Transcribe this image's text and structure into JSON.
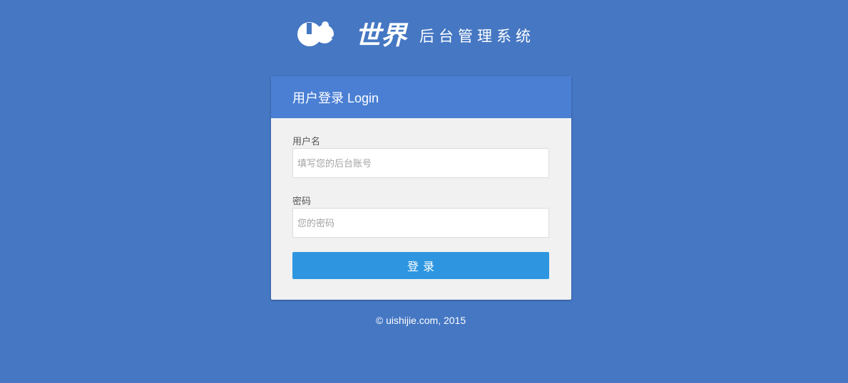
{
  "logo": {
    "mark_text": "UI世界",
    "subtitle": "后台管理系统"
  },
  "login": {
    "title": "用户登录 Login",
    "username_label": "用户名",
    "username_placeholder": "填写您的后台账号",
    "username_value": "",
    "password_label": "密码",
    "password_placeholder": "您的密码",
    "password_value": "",
    "submit_label": "登录"
  },
  "footer": {
    "copyright": "© uishijie.com, 2015"
  },
  "colors": {
    "background": "#4577c3",
    "header": "#4a7fd4",
    "button": "#2e96e0",
    "card": "#f1f1f1"
  }
}
